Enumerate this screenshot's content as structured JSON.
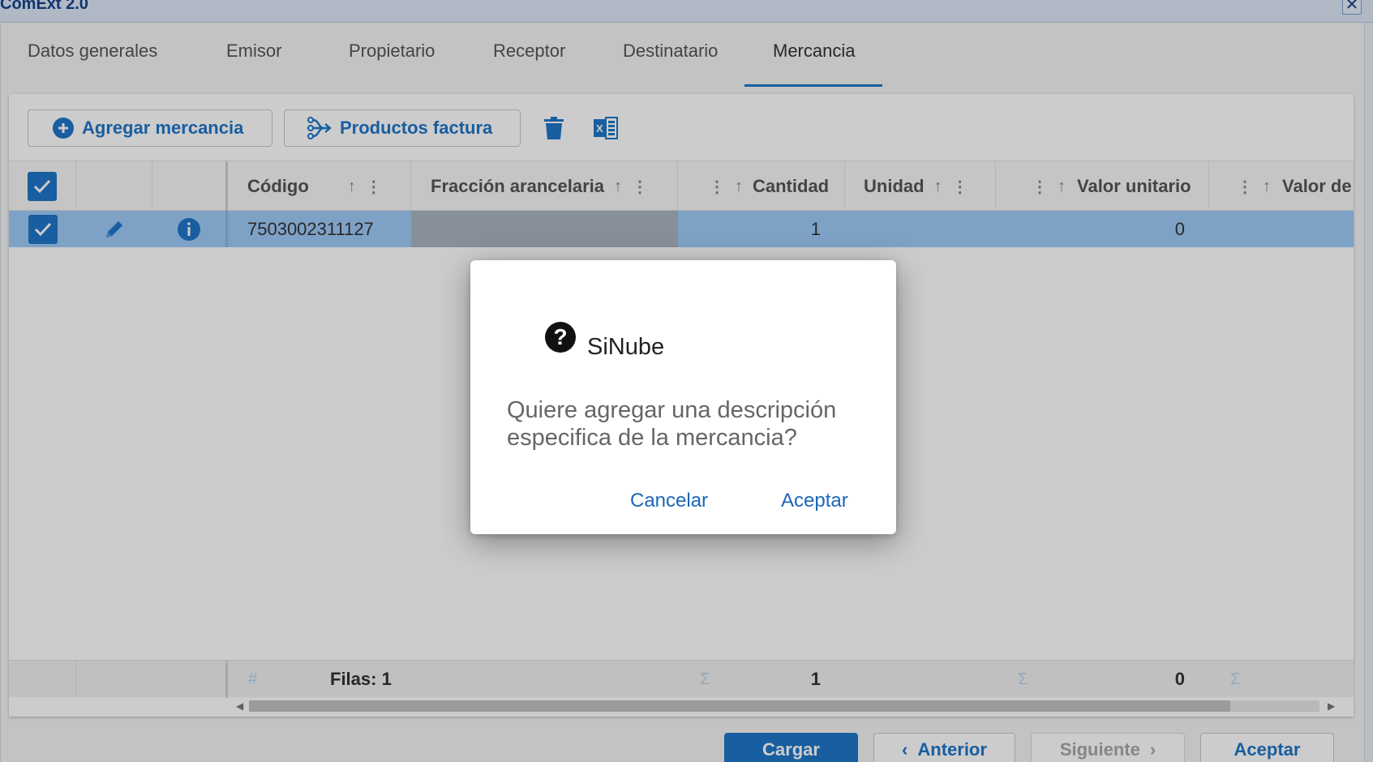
{
  "window": {
    "title": "ComExt 2.0",
    "close_glyph": "✕"
  },
  "tabs": [
    {
      "label": "Datos generales"
    },
    {
      "label": "Emisor"
    },
    {
      "label": "Propietario"
    },
    {
      "label": "Receptor"
    },
    {
      "label": "Destinatario"
    },
    {
      "label": "Mercancia",
      "active": true
    }
  ],
  "toolbar": {
    "add_label": "Agregar mercancia",
    "add_icon": "plus-circle-icon",
    "products_label": "Productos factura",
    "products_icon": "fork-arrow-icon",
    "delete_icon": "trash-icon",
    "excel_icon": "excel-icon"
  },
  "grid": {
    "columns": [
      {
        "label": "Código"
      },
      {
        "label": "Fracción arancelaria"
      },
      {
        "label": "Cantidad"
      },
      {
        "label": "Unidad"
      },
      {
        "label": "Valor unitario"
      },
      {
        "label": "Valor de"
      }
    ],
    "rows": [
      {
        "codigo": "7503002311127",
        "fraccion": "",
        "cantidad": "1",
        "unidad": "",
        "valor_unitario": "0"
      }
    ],
    "footer": {
      "filas": "Filas: 1",
      "cantidad_total": "1",
      "valor_unitario_total": "0",
      "hash": "#",
      "sigma": "Σ"
    }
  },
  "bottom_buttons": {
    "cargar": "Cargar",
    "anterior": "Anterior",
    "siguiente": "Siguiente",
    "aceptar": "Aceptar"
  },
  "dialog": {
    "icon": "question-circle-icon",
    "title": "SiNube",
    "message": "Quiere agregar una descripción especifica de la mercancia?",
    "cancel_label": "Cancelar",
    "accept_label": "Aceptar"
  },
  "colors": {
    "accent": "#1f76c9",
    "selected_row": "#9ecaf8",
    "title_text": "#15428b",
    "overlay": "rgba(0,0,0,0.2)"
  }
}
